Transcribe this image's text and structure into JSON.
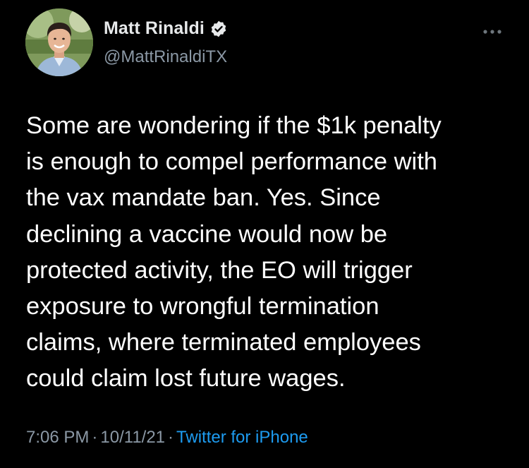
{
  "author": {
    "display_name": "Matt Rinaldi",
    "handle": "@MattRinaldiTX",
    "verified": true,
    "avatar_icon": "profile-photo"
  },
  "tweet": {
    "text": "Some are wondering if the $1k penalty\nis enough to compel performance with\nthe vax mandate ban. Yes. Since\ndeclining a vaccine would now be\nprotected activity, the EO will trigger\nexposure to wrongful termination\nclaims, where terminated employees\ncould claim lost future wages.",
    "time": "7:06 PM",
    "date": "10/11/21",
    "separator": "·",
    "source": "Twitter for iPhone"
  },
  "icons": {
    "verified": "verified-badge-icon",
    "more": "more-options-icon"
  },
  "colors": {
    "background": "#000000",
    "text": "#ffffff",
    "muted": "#8b98a5",
    "link": "#1d9bf0"
  }
}
